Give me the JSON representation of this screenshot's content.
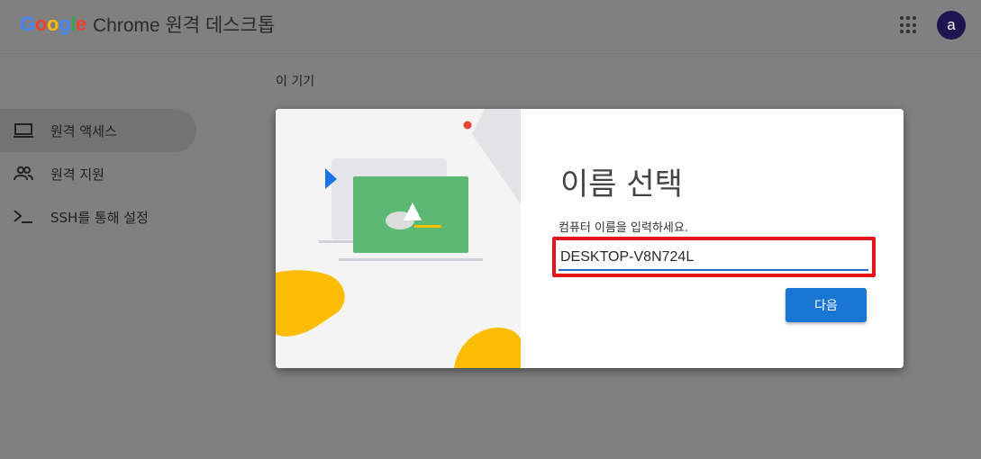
{
  "header": {
    "logo_letters": [
      {
        "char": "G",
        "color": "#4285f4"
      },
      {
        "char": "o",
        "color": "#ea4335"
      },
      {
        "char": "o",
        "color": "#fbbc05"
      },
      {
        "char": "g",
        "color": "#4285f4"
      },
      {
        "char": "l",
        "color": "#34a853"
      },
      {
        "char": "e",
        "color": "#ea4335"
      }
    ],
    "product_name": "Chrome 원격 데스크톱",
    "apps_icon": "apps-grid-icon",
    "avatar_initial": "a"
  },
  "sidebar": {
    "items": [
      {
        "label": "원격 액세스",
        "icon": "laptop-icon",
        "active": true
      },
      {
        "label": "원격 지원",
        "icon": "people-icon",
        "active": false
      },
      {
        "label": "SSH를 통해 설정",
        "icon": "terminal-icon",
        "active": false
      }
    ]
  },
  "main": {
    "section_title": "이 기기"
  },
  "dialog": {
    "title": "이름 선택",
    "prompt": "컴퓨터 이름을 입력하세요.",
    "name_value": "DESKTOP-V8N724L",
    "next_label": "다음",
    "colors": {
      "accent": "#1976d2",
      "highlight": "#e8141c",
      "laptop_screen": "#5bb974",
      "blob": "#fbbc04"
    }
  }
}
